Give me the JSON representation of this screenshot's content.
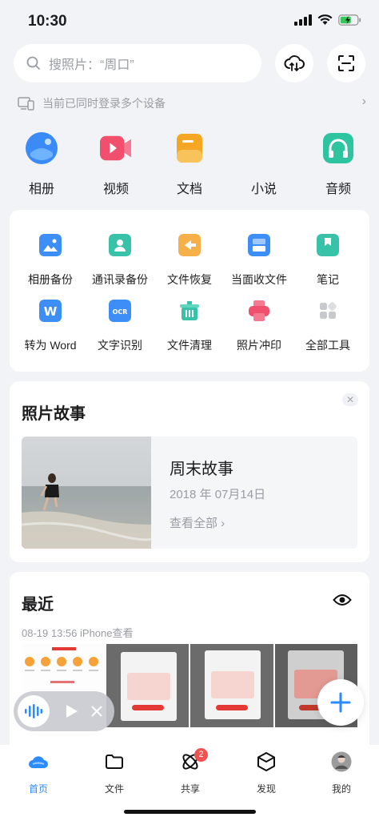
{
  "status": {
    "time": "10:30"
  },
  "search": {
    "placeholder": "搜照片：“周口”"
  },
  "devices": {
    "text": "当前已同时登录多个设备"
  },
  "features": [
    {
      "label": "相册",
      "icon": "album-icon",
      "color": "#3a8bf5"
    },
    {
      "label": "视频",
      "icon": "video-icon",
      "color": "#f0506e"
    },
    {
      "label": "文档",
      "icon": "document-icon",
      "color": "#f5a623"
    },
    {
      "label": "小说",
      "icon": "novel-icon",
      "color": "#ffffff"
    },
    {
      "label": "音频",
      "icon": "audio-icon",
      "color": "#2ec4a0"
    }
  ],
  "tools": [
    {
      "label": "相册备份",
      "icon": "album-backup-icon",
      "color": "#3d8ef6"
    },
    {
      "label": "通讯录备份",
      "icon": "contacts-backup-icon",
      "color": "#38c3a8"
    },
    {
      "label": "文件恢复",
      "icon": "file-restore-icon",
      "color": "#f6b04a"
    },
    {
      "label": "当面收文件",
      "icon": "receive-file-icon",
      "color": "#3d8ef6"
    },
    {
      "label": "笔记",
      "icon": "note-icon",
      "color": "#38c3a8"
    },
    {
      "label": "转为 Word",
      "icon": "word-convert-icon",
      "color": "#3d8ef6"
    },
    {
      "label": "文字识别",
      "icon": "ocr-icon",
      "color": "#3d8ef6"
    },
    {
      "label": "文件清理",
      "icon": "file-clean-icon",
      "color": "#38c3a8"
    },
    {
      "label": "照片冲印",
      "icon": "photo-print-icon",
      "color": "#f0506e"
    },
    {
      "label": "全部工具",
      "icon": "all-tools-icon",
      "color": "#c7c9ce"
    }
  ],
  "story": {
    "title": "照片故事",
    "name": "周末故事",
    "date": "2018 年 07月14日",
    "more": "查看全部 ›"
  },
  "recent": {
    "title": "最近",
    "meta": "08-19 13:56 iPhone查看"
  },
  "tabs": [
    {
      "label": "首页",
      "icon": "home-cloud-icon",
      "active": true
    },
    {
      "label": "文件",
      "icon": "folder-icon"
    },
    {
      "label": "共享",
      "icon": "share-icon",
      "badge": "2"
    },
    {
      "label": "发现",
      "icon": "discover-icon"
    },
    {
      "label": "我的",
      "icon": "avatar-icon"
    }
  ]
}
